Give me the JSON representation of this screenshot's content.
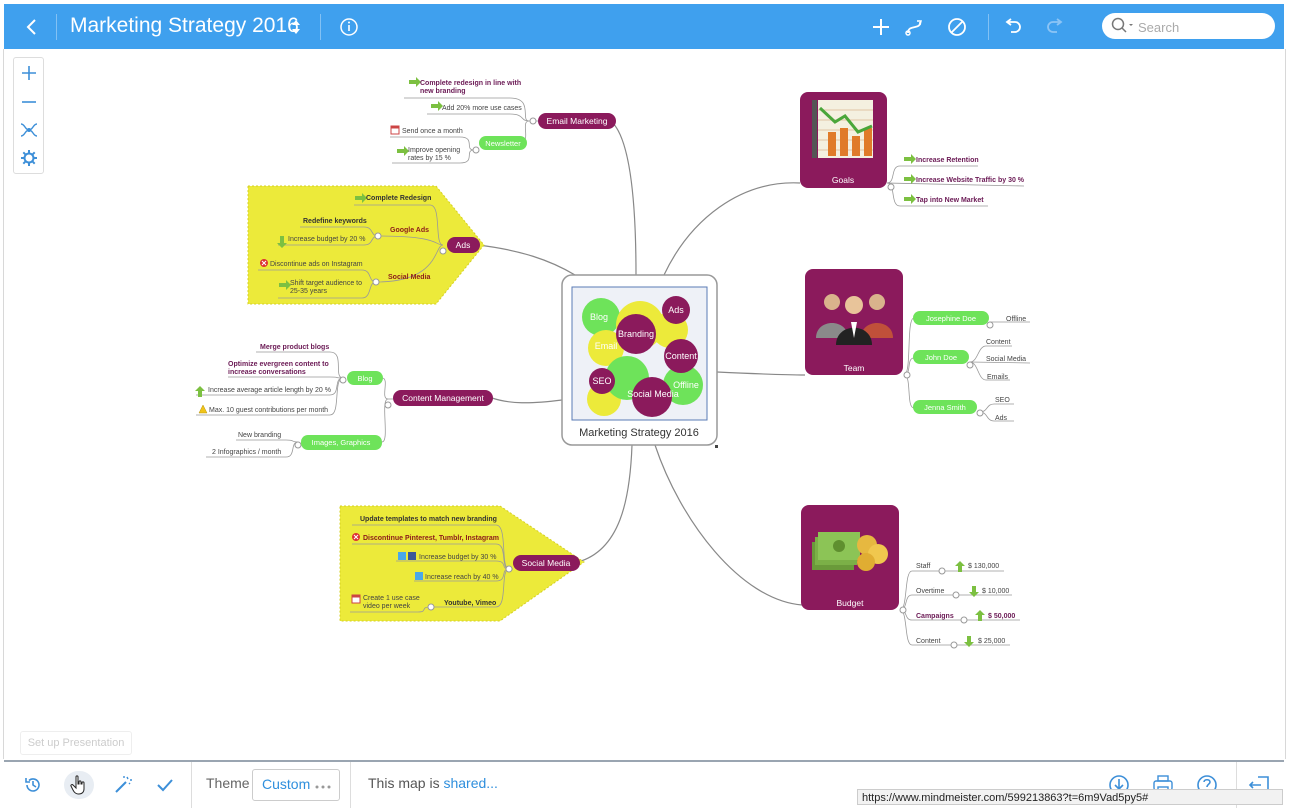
{
  "header": {
    "title": "Marketing Strategy 2016",
    "search_placeholder": "Search"
  },
  "zoom_controls": [
    "zoom-in",
    "zoom-out",
    "layout",
    "settings"
  ],
  "center": {
    "label": "Marketing Strategy 2016",
    "bubbles": [
      "Blog",
      "Ads",
      "Branding",
      "Email",
      "Content",
      "SEO",
      "Social Media",
      "Offline"
    ]
  },
  "branches": {
    "email": {
      "label": "Email Marketing",
      "items": [
        "Complete redesign in line with",
        "new branding",
        "Add 20% more use cases",
        "Send once a month",
        "Improve opening",
        "rates by 15 %"
      ],
      "sub": "Newsletter"
    },
    "ads": {
      "label": "Ads",
      "items": [
        "Complete Redesign",
        "Redefine keywords",
        "Google Ads",
        "Increase budget by 20 %",
        "Discontinue ads on Instagram",
        "Social Media",
        "Shift target audience to",
        "25-35 years"
      ]
    },
    "content": {
      "label": "Content Management",
      "items": [
        "Merge product blogs",
        "Optimize evergreen content to",
        "increase conversations",
        "Blog",
        "Increase average article length by 20 %",
        "Max. 10 guest contributions per month",
        "New branding",
        "2 Infographics / month",
        "Images, Graphics"
      ]
    },
    "social": {
      "label": "Social Media",
      "items": [
        "Update templates to match new branding",
        "Discontinue Pinterest, Tumblr, Instagram",
        "Increase budget by 30 %",
        "Increase reach by 40 %",
        "Create 1 use case",
        "video per week",
        "Youtube, Vimeo"
      ]
    },
    "goals": {
      "label": "Goals",
      "items": [
        "Increase Retention",
        "Increase Website Traffic by 30 %",
        "Tap into New Market"
      ]
    },
    "team": {
      "label": "Team",
      "members": [
        "Josephine Doe",
        "John Doe",
        "Jenna Smith"
      ],
      "items": [
        "Offline",
        "Content",
        "Social Media",
        "Emails",
        "SEO",
        "Ads"
      ]
    },
    "budget": {
      "label": "Budget",
      "rows": [
        {
          "name": "Staff",
          "value": "$ 130,000"
        },
        {
          "name": "Overtime",
          "value": "$ 10,000"
        },
        {
          "name": "Campaigns",
          "value": "$ 50,000"
        },
        {
          "name": "Content",
          "value": "$ 25,000"
        }
      ]
    }
  },
  "footer": {
    "setup": "Set up Presentation",
    "theme_label": "Theme",
    "theme_value": "Custom",
    "share_text": "This map is ",
    "share_link": "shared...",
    "status_url": "https://www.mindmeister.com/599213863?t=6m9Vad5py5#"
  },
  "colors": {
    "topbar": "#3fa0ee",
    "node": "#8b1a5c",
    "green": "#6ee35a",
    "yellow": "#ecea3a",
    "link": "#2f8fdd"
  }
}
